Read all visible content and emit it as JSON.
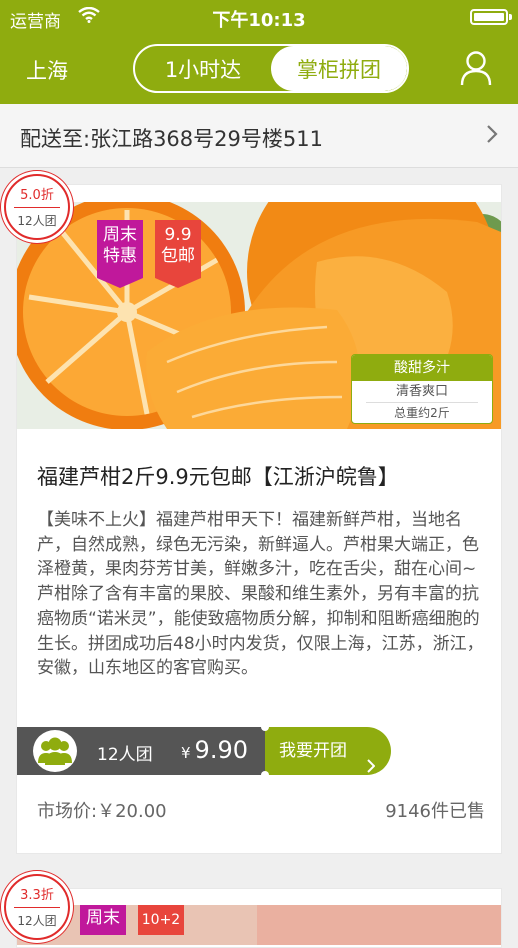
{
  "status_bar": {
    "carrier": "运营商",
    "time": "下午10:13"
  },
  "nav": {
    "city": "上海",
    "tabs": [
      "1小时达",
      "掌柜拼团"
    ],
    "active_tab": 1
  },
  "address": {
    "text": "配送至:张江路368号29号楼511"
  },
  "products": [
    {
      "discount": "5.0折",
      "group_size": "12人团",
      "ribbons": [
        "周末\n特惠",
        "9.9\n包邮"
      ],
      "taste": {
        "title": "酸甜多汁",
        "sub": "清香爽口",
        "weight": "总重约2斤"
      },
      "title": "福建芦柑2斤9.9元包邮【江浙沪皖鲁】",
      "description": "【美味不上火】福建芦柑甲天下！福建新鲜芦柑，当地名产，自然成熟，绿色无污染，新鲜逼人。芦柑果大端正，色泽橙黄，果肉芬芳甘美，鲜嫩多汁，吃在舌尖，甜在心间~芦柑除了含有丰富的果胶、果酸和维生素外，另有丰富的抗癌物质“诺米灵”，能使致癌物质分解，抑制和阻断癌细胞的生长。拼团成功后48小时内发货，仅限上海，江苏，浙江，安徽，山东地区的客官购买。",
      "group_label": "12人团",
      "price_symbol": "¥",
      "price": "9.90",
      "open_button": "我要开团",
      "market_price": "市场价:￥20.00",
      "sold": "9146件已售"
    },
    {
      "discount": "3.3折",
      "group_size": "12人团",
      "ribbons": [
        "周末",
        "10+2"
      ]
    }
  ],
  "colors": {
    "brand": "#8fac0f",
    "discount_red": "#e02b2b",
    "ribbon_purple": "#c0189b",
    "ribbon_red": "#e8453c"
  }
}
